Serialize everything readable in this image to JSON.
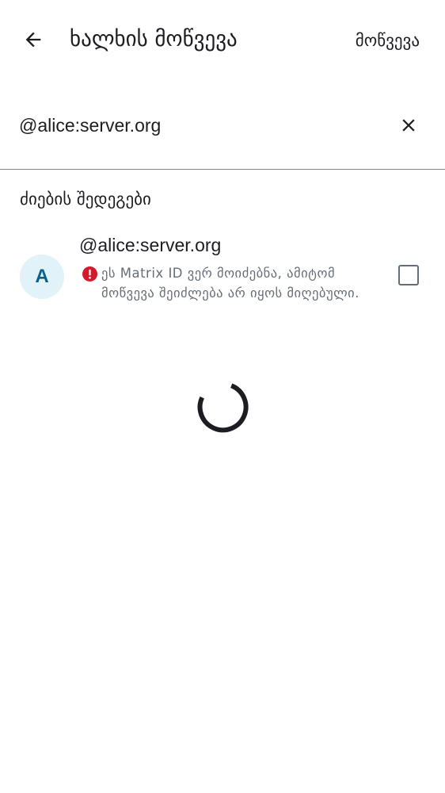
{
  "topbar": {
    "back_icon": "arrow-back-icon",
    "title": "ხალხის მოწვევა",
    "invite_action": "მოწვევა"
  },
  "search": {
    "value": "@alice:server.org",
    "clear_icon": "close-icon"
  },
  "results": {
    "header": "ძიების შედეგები",
    "items": [
      {
        "avatar_letter": "A",
        "user_id": "@alice:server.org",
        "warning_icon": "error-icon",
        "warning_text": "ეს Matrix ID ვერ მოიძებნა, ამიტომ მოწვევა შეიძლება არ იყოს მიღებული.",
        "checked": false
      }
    ]
  },
  "loading_indicator": "circular-progress-icon",
  "colors": {
    "text_primary": "#1b1d22",
    "text_secondary": "#656d77",
    "divider": "#80848c",
    "avatar_bg": "#e1f2f8",
    "avatar_text": "#0b5f8f",
    "error": "#d51928"
  }
}
